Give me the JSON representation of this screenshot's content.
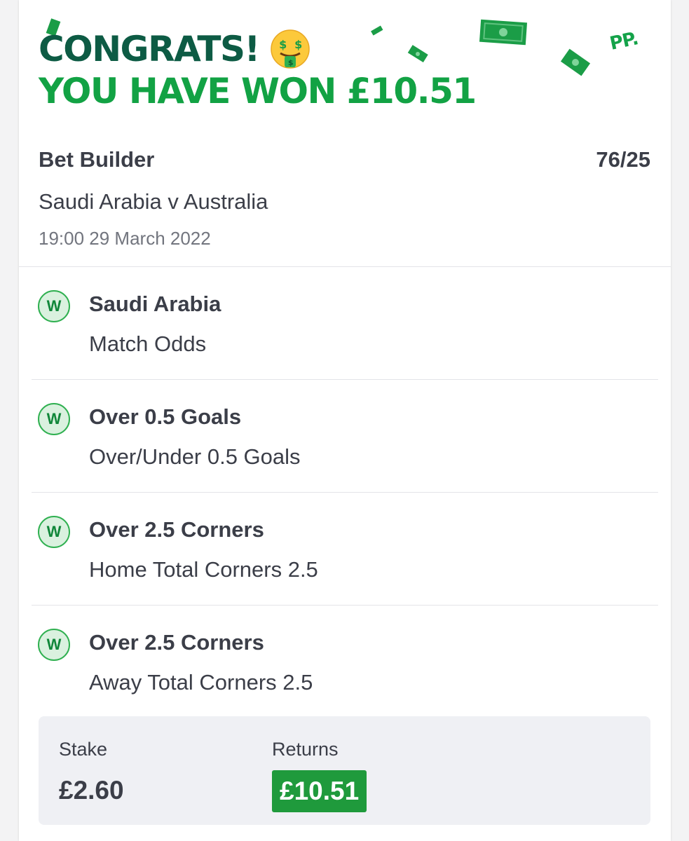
{
  "header": {
    "congrats": "CONGRATS!",
    "won_text": "YOU HAVE WON £10.51",
    "logo": "PP.",
    "emoji": "money-mouth-face-icon"
  },
  "bet": {
    "type": "Bet Builder",
    "odds": "76/25",
    "event": "Saudi Arabia v Australia",
    "datetime": "19:00 29 March 2022"
  },
  "selections": [
    {
      "result": "W",
      "name": "Saudi Arabia",
      "market": "Match Odds"
    },
    {
      "result": "W",
      "name": "Over 0.5 Goals",
      "market": "Over/Under 0.5 Goals"
    },
    {
      "result": "W",
      "name": "Over 2.5 Corners",
      "market": "Home Total Corners 2.5"
    },
    {
      "result": "W",
      "name": "Over 2.5 Corners",
      "market": "Away Total Corners 2.5"
    }
  ],
  "summary": {
    "stake_label": "Stake",
    "stake_value": "£2.60",
    "returns_label": "Returns",
    "returns_value": "£10.51"
  },
  "colors": {
    "congrats": "#0d5b44",
    "won": "#12a244",
    "returns_bg": "#1f9a3c",
    "badge_bg": "#daf1df"
  }
}
